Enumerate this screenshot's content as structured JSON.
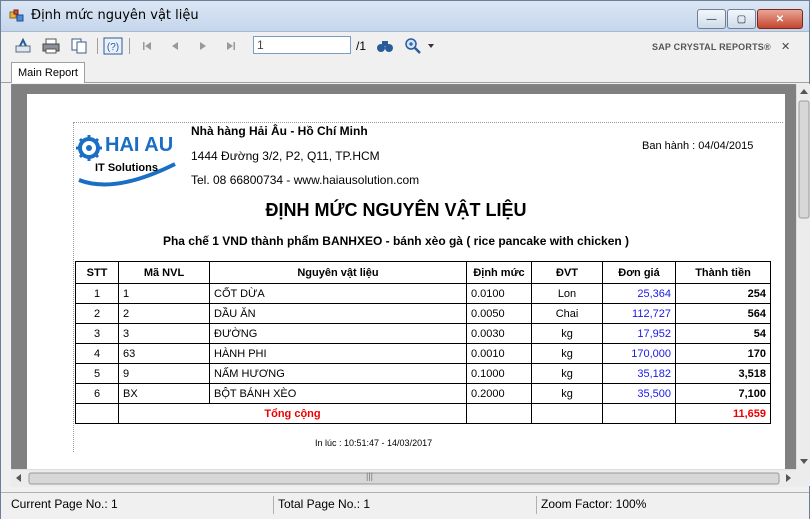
{
  "window": {
    "title": "Định mức nguyên vật liệu",
    "buttons": {
      "minimize": "—",
      "maximize": "▢",
      "close": "✕"
    }
  },
  "toolbar": {
    "page_input": "1",
    "page_total": "/1",
    "brand": "SAP CRYSTAL REPORTS®",
    "brand_close": "✕"
  },
  "tabs": [
    {
      "label": "Main Report"
    }
  ],
  "report": {
    "company": "Nhà hàng Hải Âu - Hồ Chí Minh",
    "address": "1444 Đường 3/2, P2, Q11, TP.HCM",
    "tel": "Tel. 08 66800734 - www.haiausolution.com",
    "issued": "Ban hành : 04/04/2015",
    "logo_text": "HAI AU",
    "logo_sub": "IT Solutions",
    "title": "ĐỊNH MỨC NGUYÊN VẬT LIỆU",
    "subtitle": "Pha chế 1 VND thành phẩm BANHXEO - bánh xèo gà ( rice pancake with chicken )",
    "columns": [
      "STT",
      "Mã NVL",
      "Nguyên vật liệu",
      "Định mức",
      "ĐVT",
      "Đơn giá",
      "Thành tiền"
    ],
    "rows": [
      [
        "1",
        "1",
        "CỐT DỪA",
        "0.0100",
        "Lon",
        "25,364",
        "254"
      ],
      [
        "2",
        "2",
        "DẦU ĂN",
        "0.0050",
        "Chai",
        "112,727",
        "564"
      ],
      [
        "3",
        "3",
        "ĐƯỜNG",
        "0.0030",
        "kg",
        "17,952",
        "54"
      ],
      [
        "4",
        "63",
        "HÀNH PHI",
        "0.0010",
        "kg",
        "170,000",
        "170"
      ],
      [
        "5",
        "9",
        "NẤM HƯƠNG",
        "0.1000",
        "kg",
        "35,182",
        "3,518"
      ],
      [
        "6",
        "BX",
        "BỘT BÁNH XÈO",
        "0.2000",
        "kg",
        "35,500",
        "7,100"
      ]
    ],
    "total_label": "Tổng cộng",
    "total_value": "11,659",
    "printed": "In lúc : 10:51:47 - 14/03/2017"
  },
  "scrollbar": {
    "grip": "|||"
  },
  "status": {
    "current_page": "Current Page No.: 1",
    "total_page": "Total Page No.: 1",
    "zoom": "Zoom Factor: 100%"
  },
  "colors": {
    "accent": "#1a6fc4",
    "price_blue": "#1a1ae6",
    "total_red": "#e00000"
  }
}
